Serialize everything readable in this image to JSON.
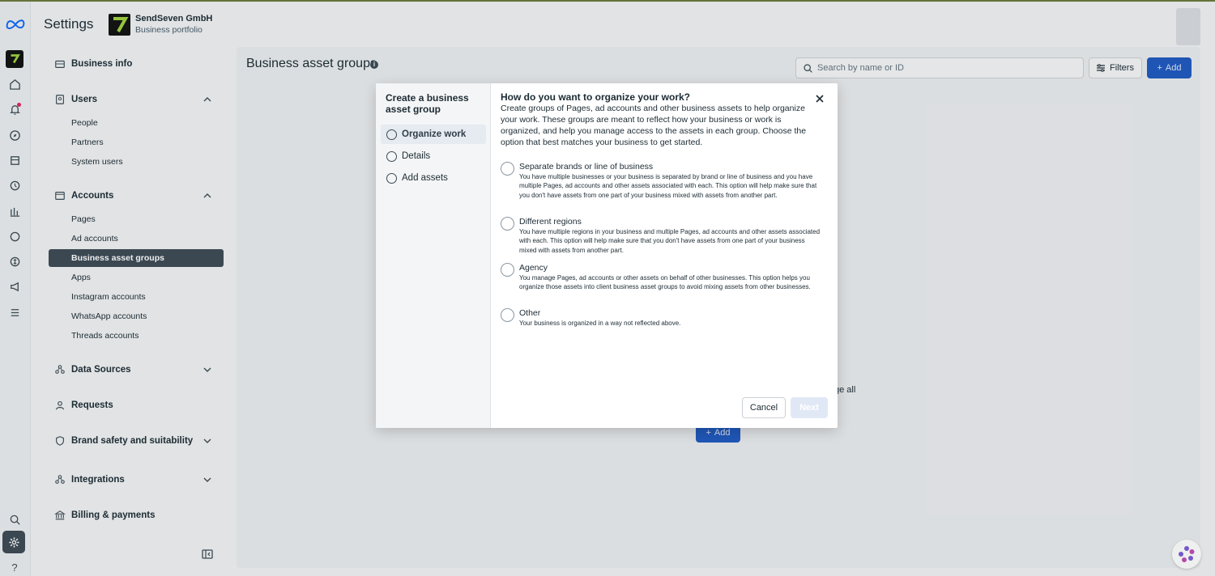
{
  "header": {
    "title": "Settings",
    "company": "SendSeven GmbH",
    "portfolio": "Business portfolio"
  },
  "sidebar": {
    "business_info": "Business info",
    "users": {
      "label": "Users",
      "items": [
        "People",
        "Partners",
        "System users"
      ]
    },
    "accounts": {
      "label": "Accounts",
      "items": [
        "Pages",
        "Ad accounts",
        "Business asset groups",
        "Apps",
        "Instagram accounts",
        "WhatsApp accounts",
        "Threads accounts"
      ],
      "active": "Business asset groups"
    },
    "data_sources": "Data Sources",
    "requests": "Requests",
    "brand_safety": "Brand safety and suitability",
    "integrations": "Integrations",
    "billing": "Billing & payments"
  },
  "main": {
    "title": "Business asset groups",
    "search_placeholder": "Search by name or ID",
    "filters_label": "Filters",
    "add_label": "Add",
    "bg_text": "ge all",
    "bg_add_label": "Add"
  },
  "modal": {
    "steps_title": "Create a business asset group",
    "steps": [
      "Organize work",
      "Details",
      "Add assets"
    ],
    "active_step": "Organize work",
    "question": "How do you want to organize your work?",
    "description": "Create groups of Pages, ad accounts and other business assets to help organize your work. These groups are meant to reflect how your business or work is organized, and help you manage access to the assets in each group. Choose the option that best matches your business to get started.",
    "options": [
      {
        "title": "Separate brands or line of business",
        "desc": "You have multiple businesses or your business is separated by brand or line of business and you have multiple Pages, ad accounts and other assets associated with each. This option will help make sure that you don't have assets from one part of your business mixed with assets from another part."
      },
      {
        "title": "Different regions",
        "desc": "You have multiple regions in your business and multiple Pages, ad accounts and other assets associated with each. This option will help make sure that you don't have assets from one part of your business mixed with assets from another part."
      },
      {
        "title": "Agency",
        "desc": "You manage Pages, ad accounts or other assets on behalf of other businesses. This option helps you organize those assets into client business asset groups to avoid mixing assets from other businesses."
      },
      {
        "title": "Other",
        "desc": "Your business is organized in a way not reflected above."
      }
    ],
    "cancel_label": "Cancel",
    "next_label": "Next"
  }
}
